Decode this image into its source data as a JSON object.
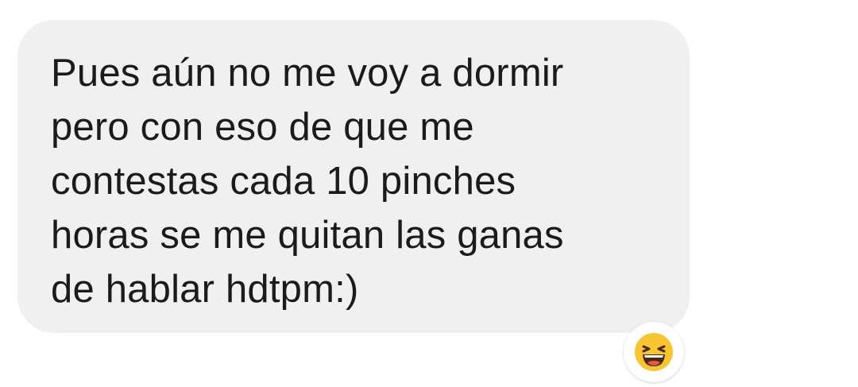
{
  "message": {
    "lines": [
      "Pues aún no me voy a dormir",
      "pero con eso de que me",
      "contestas cada 10 pinches",
      "horas se me quitan las ganas",
      "de hablar hdtpm:)"
    ]
  },
  "reaction": {
    "icon": "laughing-emoji-icon",
    "colors": {
      "face": "#f7c531",
      "mouth": "#4a2a12",
      "tongue": "#e8534a"
    }
  },
  "colors": {
    "bubble": "#f0f0f0",
    "text": "#1b1b1b",
    "background": "#ffffff"
  }
}
